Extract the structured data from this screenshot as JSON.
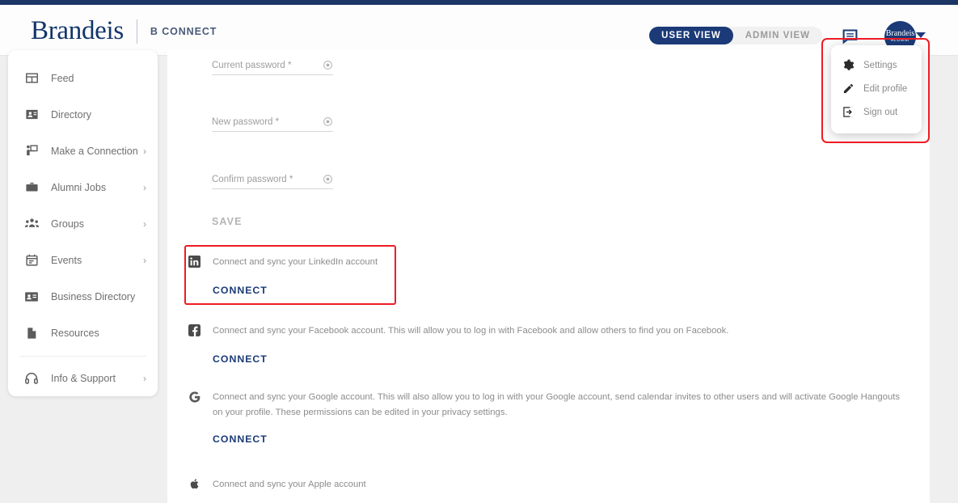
{
  "header": {
    "brand": "Brandeis",
    "brand_sub": "B CONNECT",
    "view_toggle": {
      "active": "USER VIEW",
      "inactive": "ADMIN VIEW"
    },
    "messages_icon": "message-bubble-icon",
    "avatar": {
      "line1": "Brandeis",
      "line2": "ALUMNI"
    },
    "caret_icon": "chevron-down-icon"
  },
  "profile_menu": {
    "items": [
      {
        "label": "Settings",
        "icon": "gear-icon"
      },
      {
        "label": "Edit profile",
        "icon": "pencil-icon"
      },
      {
        "label": "Sign out",
        "icon": "sign-out-icon"
      }
    ]
  },
  "sidebar": {
    "items": [
      {
        "label": "Feed",
        "icon": "feed-icon",
        "chevron": false
      },
      {
        "label": "Directory",
        "icon": "directory-card-icon",
        "chevron": false
      },
      {
        "label": "Make a Connection",
        "icon": "make-connection-icon",
        "chevron": true
      },
      {
        "label": "Alumni Jobs",
        "icon": "briefcase-icon",
        "chevron": true
      },
      {
        "label": "Groups",
        "icon": "groups-icon",
        "chevron": true
      },
      {
        "label": "Events",
        "icon": "calendar-icon",
        "chevron": true
      },
      {
        "label": "Business Directory",
        "icon": "business-card-icon",
        "chevron": false
      },
      {
        "label": "Resources",
        "icon": "document-icon",
        "chevron": false
      },
      {
        "label": "Info & Support",
        "icon": "headset-icon",
        "chevron": true
      }
    ],
    "chevron_glyph": "›"
  },
  "password_form": {
    "fields": [
      {
        "label": "Current password *",
        "value": "",
        "icon": "eye-visibility-icon"
      },
      {
        "label": "New password *",
        "value": "",
        "icon": "eye-visibility-icon"
      },
      {
        "label": "Confirm password *",
        "value": "",
        "icon": "eye-visibility-icon"
      }
    ],
    "save_label": "SAVE"
  },
  "social_accounts": [
    {
      "name": "linkedin",
      "icon": "linkedin-icon",
      "text": "Connect and sync your LinkedIn account",
      "button": "CONNECT"
    },
    {
      "name": "facebook",
      "icon": "facebook-icon",
      "text": "Connect and sync your Facebook account. This will allow you to log in with Facebook and allow others to find you on Facebook.",
      "button": "CONNECT"
    },
    {
      "name": "google",
      "icon": "google-icon",
      "text": "Connect and sync your Google account. This will also allow you to log in with your Google account, send calendar invites to other users and will activate Google Hangouts on your profile. These permissions can be edited in your privacy settings.",
      "button": "CONNECT"
    },
    {
      "name": "apple",
      "icon": "apple-icon",
      "text": "Connect and sync your Apple account",
      "button": ""
    }
  ],
  "annotations": {
    "color": "#ee1c25",
    "boxes": [
      "profile-menu-highlight",
      "linkedin-row-highlight"
    ]
  },
  "colors": {
    "brand_navy": "#12356b",
    "accent_navy": "#1b3a77",
    "page_bg": "#efefef",
    "annotation_red": "#ee1c25"
  }
}
